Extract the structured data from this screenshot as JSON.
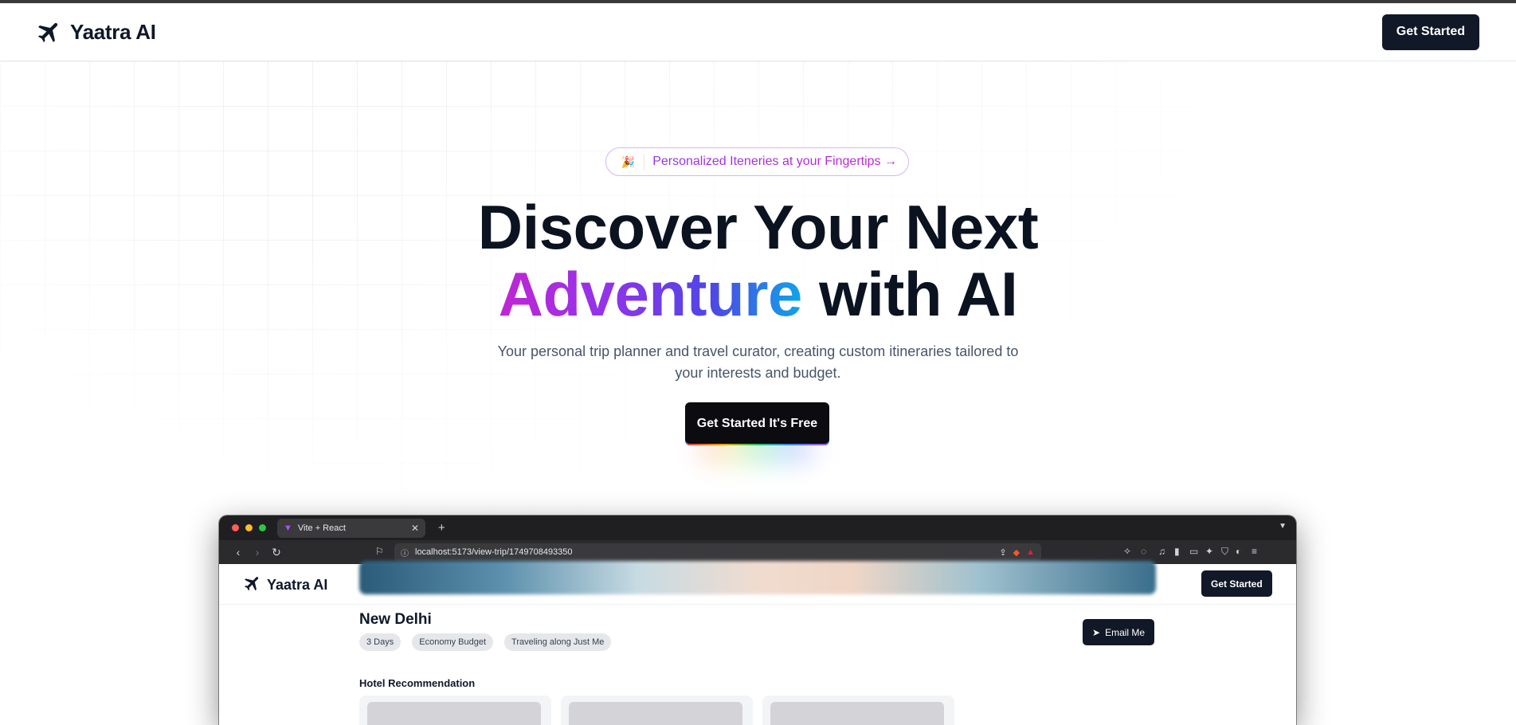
{
  "header": {
    "logo_text": "Yaatra AI",
    "cta_label": "Get Started"
  },
  "hero": {
    "badge_emoji": "🎉",
    "badge_text": "Personalized Iteneries at your Fingertips →",
    "title_line1": "Discover Your Next",
    "title_highlight": "Adventure",
    "title_rest": " with AI",
    "subtitle": "Your personal trip planner and travel curator, creating custom itineraries tailored to your interests and budget.",
    "cta_label": "Get Started It's Free"
  },
  "mockup": {
    "tab_title": "Vite + React",
    "url": "localhost:5173/view-trip/1749708493350",
    "inner_logo_text": "Yaatra AI",
    "inner_cta_label": "Get Started",
    "destination": "New Delhi",
    "chips": [
      "3 Days",
      "Economy Budget",
      "Traveling along Just Me"
    ],
    "email_label": "Email Me",
    "section_title": "Hotel Recommendation"
  },
  "colors": {
    "brand_dark": "#111827",
    "gradient_start": "#c026d3",
    "gradient_mid": "#4f46e5",
    "gradient_end": "#0ea5e9",
    "badge_text": "#9333ea"
  },
  "icons": {
    "logo": "airplane-icon",
    "email": "send-icon",
    "tab": "vite-icon"
  }
}
